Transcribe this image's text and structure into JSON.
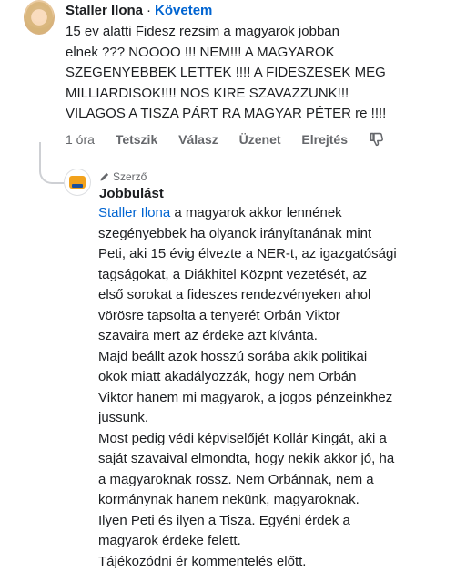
{
  "comment": {
    "author": "Staller Ilona",
    "separator": "·",
    "follow_label": "Követem",
    "text_lines": [
      "15 ev alatti Fidesz rezsim a magyarok jobban",
      "elnek ??? NOOOO !!! NEM!!! A MAGYAROK",
      "SZEGENYEBBEK LETTEK !!!! A FIDESZESEK MEG",
      "MILLIARDISOK!!!! NOS KIRE SZAVAZZUNK!!!",
      "VILAGOS A TISZA PÁRT RA MAGYAR PÉTER re !!!!"
    ],
    "time": "1 óra",
    "actions": [
      "Tetszik",
      "Válasz",
      "Üzenet",
      "Elrejtés"
    ],
    "thumb_icon": "thumbs-down-icon"
  },
  "reply": {
    "badge": "Szerző",
    "badge_icon": "pencil-icon",
    "author": "Jobbulást",
    "mention": "Staller Ilona",
    "first_line_rest": " a magyarok akkor lennének",
    "text_lines": [
      "szegényebbek ha olyanok irányítanának mint",
      "Peti, aki 15 évig élvezte a NER-t, az igazgatósági",
      "tagságokat, a Diákhitel Közpnt vezetését, az",
      "első sorokat a fideszes rendezvényeken ahol",
      "vörösre tapsolta a tenyerét Orbán Viktor",
      "szavaira mert az érdeke azt kívánta.",
      "Majd beállt azok hosszú sorába akik politikai",
      "okok miatt akadályozzák, hogy nem Orbán",
      "Viktor hanem mi magyarok, a jogos pénzeinkhez",
      "jussunk.",
      "Most pedig védi képviselőjét Kollár Kingát, aki a",
      "saját szavaival elmondta, hogy nekik akkor jó, ha",
      "a magyaroknak rossz. Nem Orbánnak, nem a",
      "kormánynak hanem nekünk, magyaroknak.",
      "Ilyen Peti és ilyen a Tisza. Egyéni érdek a",
      "magyarok érdeke felett.",
      "Tájékozódni ér kommentelés előtt."
    ]
  },
  "colors": {
    "link": "#0064d1",
    "text": "#1c1e21",
    "muted": "#65676b",
    "thread": "#ced0d4"
  }
}
